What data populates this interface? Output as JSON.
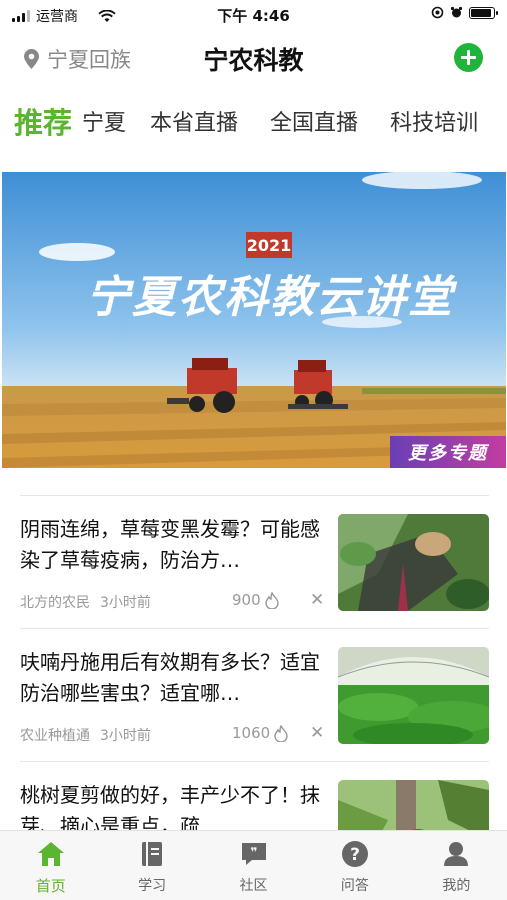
{
  "status_bar": {
    "carrier": "运营商",
    "time": "下午 4:46"
  },
  "header": {
    "location": "宁夏回族",
    "title": "宁农科教"
  },
  "tabs": [
    "推荐",
    "宁夏",
    "本省直播",
    "全国直播",
    "科技培训"
  ],
  "banner": {
    "year": "2021",
    "headline": "宁夏农科教云讲堂",
    "more_topics": "更多专题"
  },
  "news": [
    {
      "title": "阴雨连绵，草莓变黑发霉？可能感染了草莓疫病，防治方…",
      "source": "北方的农民",
      "time": "3小时前",
      "views": "900"
    },
    {
      "title": "呋喃丹施用后有效期有多长？适宜防治哪些害虫？适宜哪…",
      "source": "农业种植通",
      "time": "3小时前",
      "views": "1060"
    },
    {
      "title": "桃树夏剪做的好，丰产少不了！抹芽、摘心是重点，疏",
      "source": "",
      "time": "",
      "views": ""
    }
  ],
  "bottom_nav": [
    "首页",
    "学习",
    "社区",
    "问答",
    "我的"
  ],
  "colors": {
    "accent": "#5cb531",
    "add_button": "#1fb53b",
    "banner_tag": "#c0392b"
  },
  "battery_level": 0.9
}
